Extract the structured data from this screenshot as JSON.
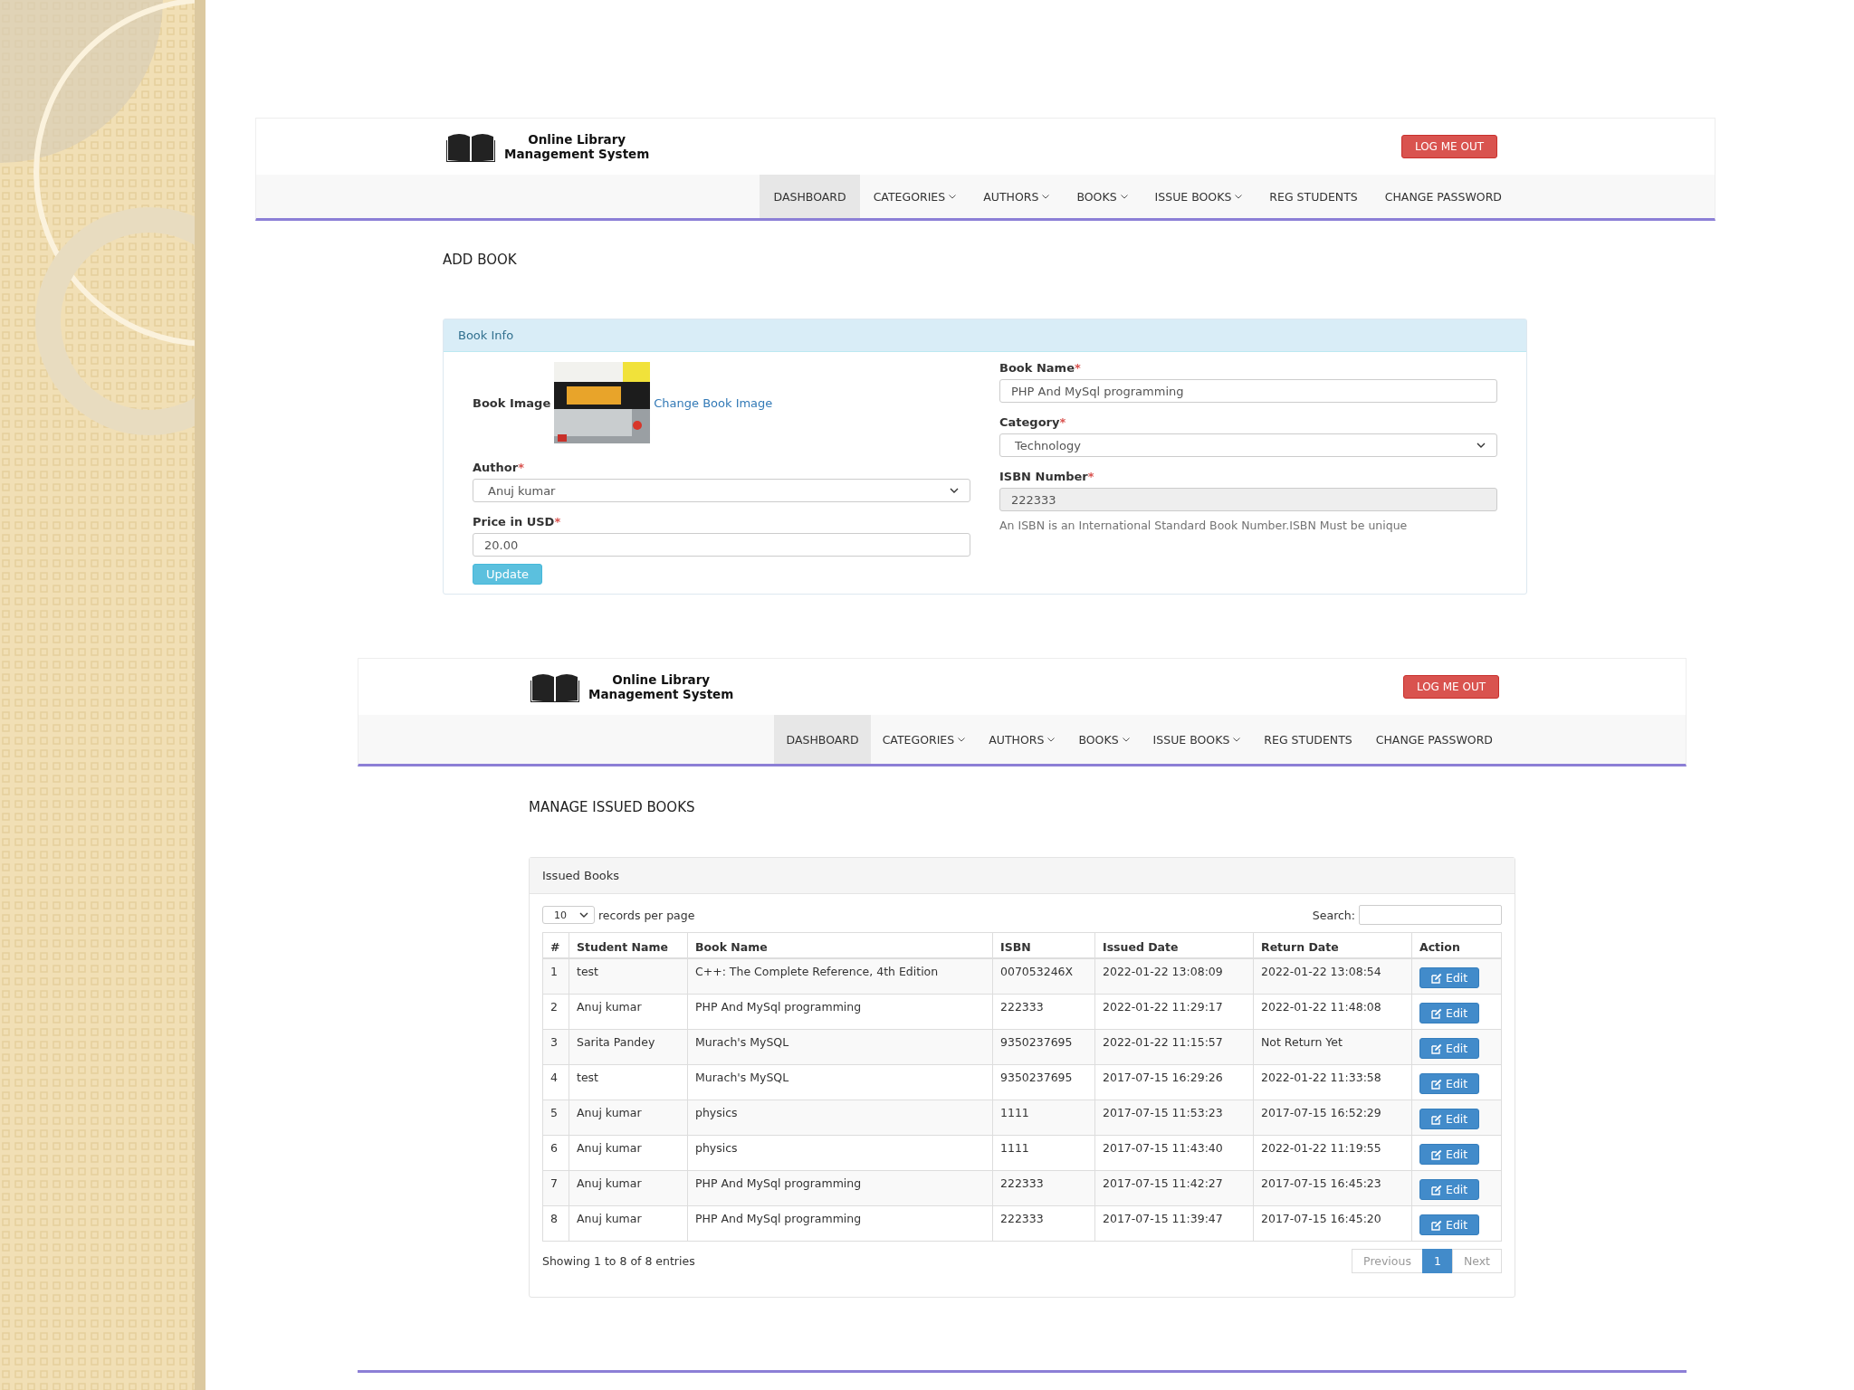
{
  "add_book_page": {
    "header": {
      "logo_line_1": "Online Library",
      "logo_line_2": "Management System",
      "logout_button": "LOG ME OUT"
    },
    "nav": [
      {
        "label": "DASHBOARD",
        "kind": "link",
        "selected": true
      },
      {
        "label": "CATEGORIES",
        "kind": "dropdown",
        "selected": false
      },
      {
        "label": "AUTHORS",
        "kind": "dropdown",
        "selected": false
      },
      {
        "label": "BOOKS",
        "kind": "dropdown",
        "selected": false
      },
      {
        "label": "ISSUE BOOKS",
        "kind": "dropdown",
        "selected": false
      },
      {
        "label": "REG STUDENTS",
        "kind": "link",
        "selected": false
      },
      {
        "label": "CHANGE PASSWORD",
        "kind": "link",
        "selected": false
      }
    ],
    "title": "ADD BOOK",
    "panel": {
      "heading": "Book Info",
      "left_fields": [
        {
          "label": "Book Image",
          "link": "Change Book Image"
        },
        {
          "kind": "select",
          "label": "Author",
          "required_mark": "*",
          "value": "Anuj kumar",
          "disabled": false
        },
        {
          "kind": "text",
          "label": "Price in USD",
          "required_mark": "*",
          "value": "20.00",
          "disabled": false
        }
      ],
      "right_fields": [
        {
          "kind": "text",
          "label": "Book Name",
          "required_mark": "*",
          "value": "PHP And MySql programming",
          "disabled": false
        },
        {
          "kind": "select",
          "label": "Category",
          "required_mark": "*",
          "value": "Technology",
          "disabled": false
        },
        {
          "kind": "text",
          "label": "ISBN Number",
          "required_mark": "*",
          "value": "222333",
          "disabled": true,
          "help": "An ISBN is an International Standard Book Number.ISBN Must be unique"
        }
      ],
      "submit_button": "Update"
    }
  },
  "issued_books_page": {
    "header": {
      "logo_line_1": "Online Library",
      "logo_line_2": "Management System",
      "logout_button": "LOG ME OUT"
    },
    "nav": [
      {
        "label": "DASHBOARD",
        "kind": "link",
        "selected": true
      },
      {
        "label": "CATEGORIES",
        "kind": "dropdown",
        "selected": false
      },
      {
        "label": "AUTHORS",
        "kind": "dropdown",
        "selected": false
      },
      {
        "label": "BOOKS",
        "kind": "dropdown",
        "selected": false
      },
      {
        "label": "ISSUE BOOKS",
        "kind": "dropdown",
        "selected": false
      },
      {
        "label": "REG STUDENTS",
        "kind": "link",
        "selected": false
      },
      {
        "label": "CHANGE PASSWORD",
        "kind": "link",
        "selected": false
      }
    ],
    "title": "MANAGE ISSUED BOOKS",
    "panel": {
      "heading": "Issued Books",
      "page_size": "10",
      "page_size_label": "records per page",
      "search_label": "Search:",
      "table": {
        "columns": [
          "#",
          "Student Name",
          "Book Name",
          "ISBN",
          "Issued Date",
          "Return Date",
          "Action"
        ],
        "rows": [
          {
            "cells": [
              "1",
              "test",
              "C++: The Complete Reference, 4th Edition",
              "007053246X",
              "2022-01-22 13:08:09",
              "2022-01-22 13:08:54"
            ],
            "action": "Edit"
          },
          {
            "cells": [
              "2",
              "Anuj kumar",
              "PHP And MySql programming",
              "222333",
              "2022-01-22 11:29:17",
              "2022-01-22 11:48:08"
            ],
            "action": "Edit"
          },
          {
            "cells": [
              "3",
              "Sarita Pandey",
              "Murach's MySQL",
              "9350237695",
              "2022-01-22 11:15:57",
              "Not Return Yet"
            ],
            "action": "Edit"
          },
          {
            "cells": [
              "4",
              "test",
              "Murach's MySQL",
              "9350237695",
              "2017-07-15 16:29:26",
              "2022-01-22 11:33:58"
            ],
            "action": "Edit"
          },
          {
            "cells": [
              "5",
              "Anuj kumar",
              "physics",
              "1111",
              "2017-07-15 11:53:23",
              "2017-07-15 16:52:29"
            ],
            "action": "Edit"
          },
          {
            "cells": [
              "6",
              "Anuj kumar",
              "physics",
              "1111",
              "2017-07-15 11:43:40",
              "2022-01-22 11:19:55"
            ],
            "action": "Edit"
          },
          {
            "cells": [
              "7",
              "Anuj kumar",
              "PHP And MySql programming",
              "222333",
              "2017-07-15 11:42:27",
              "2017-07-15 16:45:23"
            ],
            "action": "Edit"
          },
          {
            "cells": [
              "8",
              "Anuj kumar",
              "PHP And MySql programming",
              "222333",
              "2017-07-15 11:39:47",
              "2017-07-15 16:45:20"
            ],
            "action": "Edit"
          }
        ]
      },
      "summary": "Showing 1 to 8 of 8 entries",
      "pagination": [
        {
          "label": "Previous",
          "selected": false
        },
        {
          "label": "1",
          "selected": true
        },
        {
          "label": "Next",
          "selected": false
        }
      ]
    }
  }
}
